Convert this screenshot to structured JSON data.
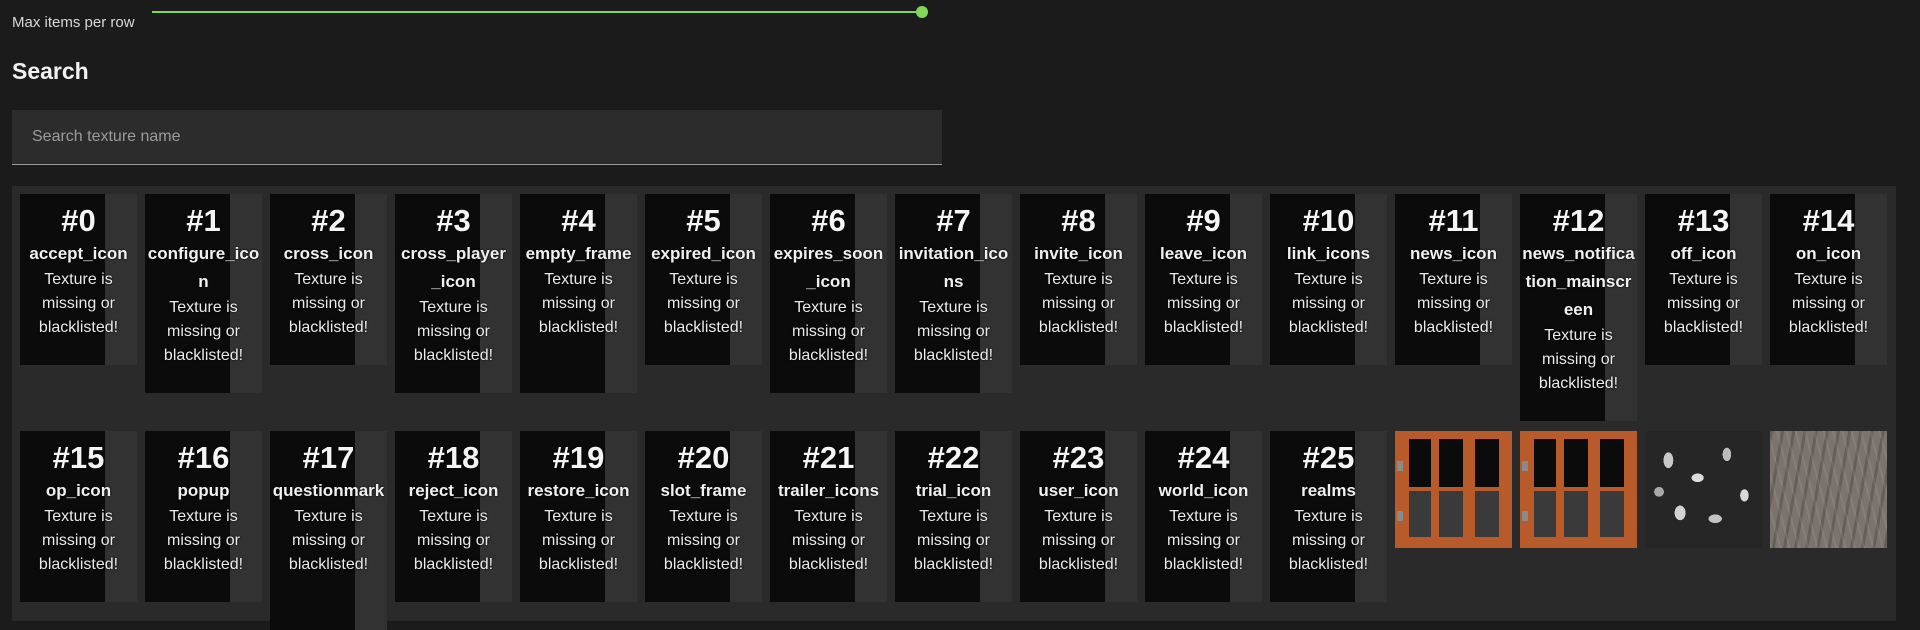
{
  "slider": {
    "label": "Max items per row",
    "value_fraction": 1.0,
    "accent": "#7ed957"
  },
  "search": {
    "title": "Search",
    "placeholder": "Search texture name",
    "value": ""
  },
  "missing_text": "Texture is missing or blacklisted!",
  "items": [
    {
      "num": "#0",
      "name": "accept_icon"
    },
    {
      "num": "#1",
      "name": "configure_icon"
    },
    {
      "num": "#2",
      "name": "cross_icon"
    },
    {
      "num": "#3",
      "name": "cross_player_icon"
    },
    {
      "num": "#4",
      "name": "empty_frame"
    },
    {
      "num": "#5",
      "name": "expired_icon"
    },
    {
      "num": "#6",
      "name": "expires_soon_icon"
    },
    {
      "num": "#7",
      "name": "invitation_icons"
    },
    {
      "num": "#8",
      "name": "invite_icon"
    },
    {
      "num": "#9",
      "name": "leave_icon"
    },
    {
      "num": "#10",
      "name": "link_icons"
    },
    {
      "num": "#11",
      "name": "news_icon"
    },
    {
      "num": "#12",
      "name": "news_notification_mainscreen"
    },
    {
      "num": "#13",
      "name": "off_icon"
    },
    {
      "num": "#14",
      "name": "on_icon"
    },
    {
      "num": "#15",
      "name": "op_icon"
    },
    {
      "num": "#16",
      "name": "popup"
    },
    {
      "num": "#17",
      "name": "questionmark"
    },
    {
      "num": "#18",
      "name": "reject_icon"
    },
    {
      "num": "#19",
      "name": "restore_icon"
    },
    {
      "num": "#20",
      "name": "slot_frame"
    },
    {
      "num": "#21",
      "name": "trailer_icons"
    },
    {
      "num": "#22",
      "name": "trial_icon"
    },
    {
      "num": "#23",
      "name": "user_icon"
    },
    {
      "num": "#24",
      "name": "world_icon"
    },
    {
      "num": "#25",
      "name": "realms"
    }
  ],
  "textures": [
    {
      "kind": "window",
      "icon": "window-texture-icon"
    },
    {
      "kind": "window",
      "icon": "window-texture-icon"
    },
    {
      "kind": "leaves",
      "icon": "leaves-texture-icon"
    },
    {
      "kind": "stone",
      "icon": "stone-texture-icon"
    }
  ]
}
